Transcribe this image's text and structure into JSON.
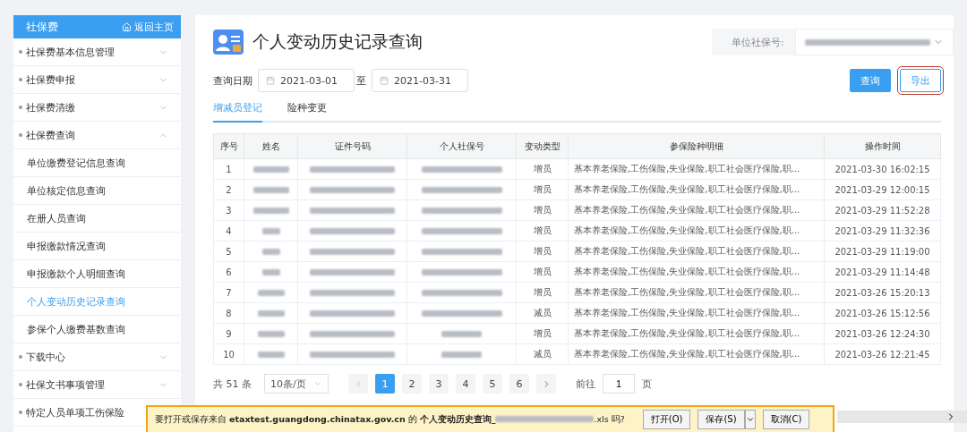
{
  "sidebar": {
    "title": "社保费",
    "home_link": "返回主页",
    "items": [
      {
        "label": "社保费基本信息管理",
        "expanded": false
      },
      {
        "label": "社保费申报",
        "expanded": false
      },
      {
        "label": "社保费清缴",
        "expanded": false
      },
      {
        "label": "社保费查询",
        "expanded": true,
        "children": [
          {
            "label": "单位缴费登记信息查询",
            "selected": false
          },
          {
            "label": "单位核定信息查询",
            "selected": false
          },
          {
            "label": "在册人员查询",
            "selected": false
          },
          {
            "label": "申报缴款情况查询",
            "selected": false
          },
          {
            "label": "申报缴款个人明细查询",
            "selected": false
          },
          {
            "label": "个人变动历史记录查询",
            "selected": true
          },
          {
            "label": "参保个人缴费基数查询",
            "selected": false
          }
        ]
      },
      {
        "label": "下载中心",
        "expanded": false
      },
      {
        "label": "社保文书事项管理",
        "expanded": false
      },
      {
        "label": "特定人员单项工伤保险",
        "expanded": false
      }
    ]
  },
  "page": {
    "title": "个人变动历史记录查询",
    "unit_label": "单位社保号:"
  },
  "filter": {
    "label": "查询日期",
    "start": "2021-03-01",
    "separator": "至",
    "end": "2021-03-31",
    "buttons": [
      {
        "label": "查询",
        "kind": "primary"
      },
      {
        "label": "导出",
        "kind": "outline"
      }
    ]
  },
  "tabs": [
    {
      "label": "增减员登记",
      "selected": true
    },
    {
      "label": "险种变更",
      "selected": false
    }
  ],
  "table": {
    "columns": [
      "序号",
      "姓名",
      "证件号码",
      "个人社保号",
      "变动类型",
      "参保险种明细",
      "操作时间"
    ],
    "rows": [
      {
        "no": "1",
        "type": "增员",
        "detail": "基本养老保险,工伤保险,失业保险,职工社会医疗保险,职...",
        "time": "2021-03-30 16:02:15"
      },
      {
        "no": "2",
        "type": "增员",
        "detail": "基本养老保险,工伤保险,失业保险,职工社会医疗保险,职...",
        "time": "2021-03-29 12:00:15"
      },
      {
        "no": "3",
        "type": "增员",
        "detail": "基本养老保险,工伤保险,失业保险,职工社会医疗保险,职...",
        "time": "2021-03-29 11:52:28"
      },
      {
        "no": "4",
        "type": "增员",
        "detail": "基本养老保险,工伤保险,失业保险,职工社会医疗保险,职...",
        "time": "2021-03-29 11:32:36"
      },
      {
        "no": "5",
        "type": "增员",
        "detail": "基本养老保险,工伤保险,失业保险,职工社会医疗保险,职...",
        "time": "2021-03-29 11:19:00"
      },
      {
        "no": "6",
        "type": "增员",
        "detail": "基本养老保险,工伤保险,失业保险,职工社会医疗保险,职...",
        "time": "2021-03-29 11:14:48"
      },
      {
        "no": "7",
        "type": "增员",
        "detail": "基本养老保险,工伤保险,失业保险,职工社会医疗保险,职...",
        "time": "2021-03-26 15:20:13"
      },
      {
        "no": "8",
        "type": "减员",
        "detail": "基本养老保险,工伤保险,失业保险,职工社会医疗保险,职...",
        "time": "2021-03-26 15:12:56"
      },
      {
        "no": "9",
        "type": "增员",
        "detail": "基本养老保险,工伤保险,失业保险,职工社会医疗保险,职...",
        "time": "2021-03-26 12:24:30"
      },
      {
        "no": "10",
        "type": "减员",
        "detail": "基本养老保险,工伤保险,失业保险,职工社会医疗保险,职...",
        "time": "2021-03-26 12:21:45"
      }
    ]
  },
  "pagination": {
    "total": "共 51 条",
    "page_size": "10条/页",
    "pages": [
      {
        "label": "1",
        "selected": true
      },
      {
        "label": "2",
        "selected": false
      },
      {
        "label": "3",
        "selected": false
      },
      {
        "label": "4",
        "selected": false
      },
      {
        "label": "5",
        "selected": false
      },
      {
        "label": "6",
        "selected": false
      }
    ],
    "goto_label": "前往",
    "goto_value": "1",
    "goto_suffix": "页"
  },
  "download_bar": {
    "prefix": "要打开或保存来自 **etaxtest.guangdong.chinatax.gov.cn** 的 **个人变动历史查询_**",
    "suffix": ".xls 吗?",
    "buttons": [
      "打开(O)",
      "保存(S)",
      "取消(C)"
    ]
  }
}
